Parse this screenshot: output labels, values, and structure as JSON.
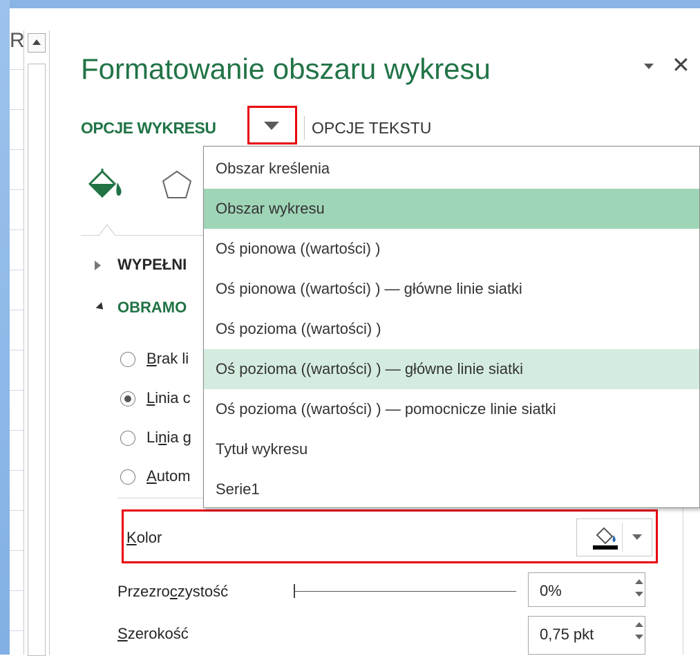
{
  "sheet": {
    "column_letter": "R"
  },
  "pane": {
    "title": "Formatowanie obszaru wykresu",
    "tabs": {
      "chart_options": "OPCJE WYKRESU",
      "text_options": "OPCJE TEKSTU"
    }
  },
  "sections": {
    "fill": "WYPEŁNI",
    "border": "OBRAMO"
  },
  "line_options": [
    {
      "label_u": "B",
      "label_rest": "rak li",
      "checked": false
    },
    {
      "label_u": "L",
      "label_rest": "inia c",
      "checked": true
    },
    {
      "label_pre": "Li",
      "label_u": "n",
      "label_rest": "ia g",
      "checked": false
    },
    {
      "label_u": "A",
      "label_rest": "utom",
      "checked": false
    }
  ],
  "dropdown": {
    "items": [
      "Obszar kreślenia",
      "Obszar wykresu",
      "Oś  pionowa  ((wartości) )",
      "Oś  pionowa  ((wartości) )  — główne linie siatki",
      "Oś  pozioma  ((wartości) )",
      "Oś  pozioma  ((wartości) )  — główne linie siatki",
      "Oś  pozioma  ((wartości) )  — pomocnicze linie siatki",
      "Tytuł wykresu",
      "Serie1"
    ],
    "selected_index": 1,
    "hovered_index": 5
  },
  "properties": {
    "color": {
      "label_u": "K",
      "label_rest": "olor"
    },
    "transparency": {
      "label_pre": "Przezro",
      "label_u": "c",
      "label_rest": "zystość",
      "value": "0%"
    },
    "width": {
      "label_u": "S",
      "label_rest": "zerokość",
      "value": "0,75 pkt"
    }
  },
  "colors": {
    "accent": "#217346",
    "highlight_red": "#e8000b",
    "selected": "#9fd5b7",
    "hover": "#d4ecdf"
  }
}
